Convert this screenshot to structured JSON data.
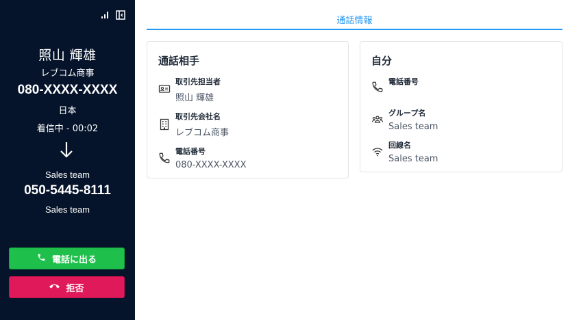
{
  "caller": {
    "name": "照山 輝雄",
    "company": "レブコム商事",
    "number": "080-XXXX-XXXX",
    "country": "日本",
    "status": "着信中 - 00:02"
  },
  "line": {
    "team": "Sales team",
    "number": "050-5445-8111",
    "team_secondary": "Sales team"
  },
  "buttons": {
    "answer_label": "電話に出る",
    "reject_label": "拒否"
  },
  "tabs": [
    {
      "label": "通話情報",
      "active": true
    }
  ],
  "partner_card": {
    "title": "通話相手",
    "fields": [
      {
        "label": "取引先担当者",
        "value": "照山 輝雄",
        "icon": "contact-card-icon"
      },
      {
        "label": "取引先会社名",
        "value": "レブコム商事",
        "icon": "building-icon"
      },
      {
        "label": "電話番号",
        "value": "080-XXXX-XXXX",
        "icon": "phone-icon"
      }
    ]
  },
  "self_card": {
    "title": "自分",
    "fields": [
      {
        "label": "電話番号",
        "value": "",
        "icon": "phone-icon"
      },
      {
        "label": "グループ名",
        "value": "Sales team",
        "icon": "group-icon"
      },
      {
        "label": "回線名",
        "value": "Sales team",
        "icon": "wifi-icon"
      }
    ]
  },
  "colors": {
    "sidebar_bg": "#06142b",
    "accent": "#2196f3",
    "answer": "#1fbf4c",
    "reject": "#e0195a"
  }
}
